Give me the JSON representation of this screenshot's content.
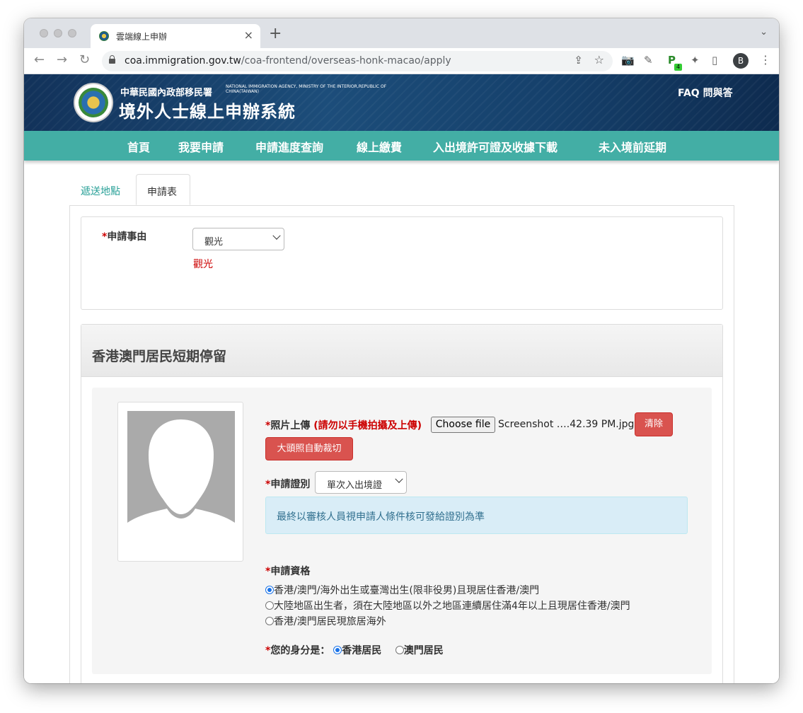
{
  "browser": {
    "tab_title": "雲端線上申辦",
    "tab_close": "×",
    "new_tab": "+",
    "url_host": "coa.immigration.gov.tw",
    "url_path": "/coa-frontend/overseas-honk-macao/apply",
    "profile_initial": "B",
    "ext_badge": "4"
  },
  "header": {
    "agency_zh": "中華民國內政部移民署",
    "agency_en": "NATIONAL IMMIGRATION AGENCY, MINISTRY OF THE INTERIOR,REPUBLIC OF CHINA(TAIWAN)",
    "system_title": "境外人士線上申辦系統",
    "faq": "FAQ 問與答"
  },
  "nav": {
    "items": [
      "首頁",
      "我要申請",
      "申請進度查詢",
      "線上繳費",
      "入出境許可證及收據下載",
      "未入境前延期"
    ]
  },
  "tabs": {
    "delivery": "遞送地點",
    "form": "申請表"
  },
  "reason": {
    "label": "申請事由",
    "selected": "觀光",
    "echo": "觀光"
  },
  "section": {
    "title": "香港澳門居民短期停留",
    "photo_label": "照片上傳",
    "photo_warning": "(請勿以手機拍攝及上傳)",
    "choose_file": "Choose file",
    "file_name": "Screenshot ….42.39 PM.jpg",
    "clear_button": "清除",
    "crop_button": "大頭照自動裁切",
    "cert_label": "申請證別",
    "cert_selected": "單次入出境證",
    "info_text": "最終以審核人員視申請人條件核可發給證別為準",
    "qual_label": "申請資格",
    "qual_options": [
      "香港/澳門/海外出生或臺灣出生(限非役男)且現居住香港/澳門",
      "大陸地區出生者，須在大陸地區以外之地區連續居住滿4年以上且現居住香港/澳門",
      "香港/澳門居民現旅居海外"
    ],
    "qual_selected_index": 0,
    "identity_label": "您的身分是：",
    "identity_options": [
      "香港居民",
      "澳門居民"
    ],
    "identity_selected_index": 0
  },
  "colors": {
    "nav_teal": "#43aea5",
    "header_navy": "#15406b",
    "danger_red": "#d9534f",
    "info_blue": "#d9edf7"
  }
}
